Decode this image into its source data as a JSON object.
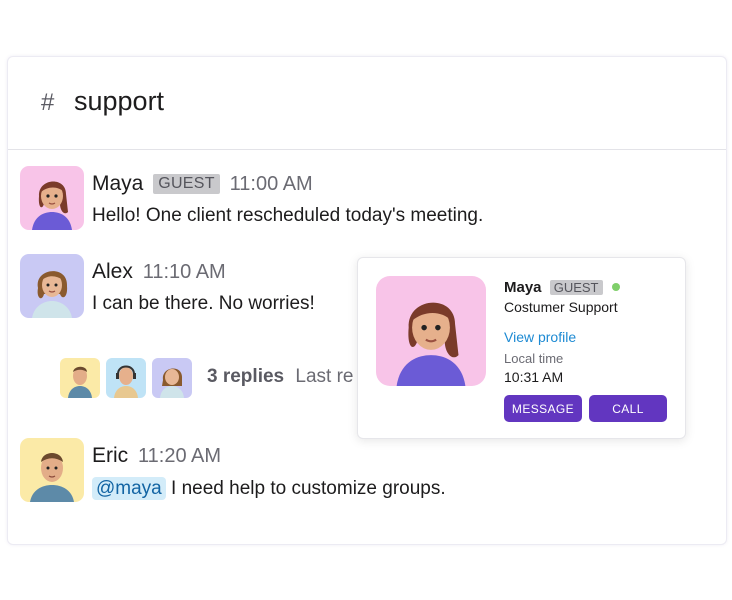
{
  "channel": {
    "hash": "#",
    "name": "support"
  },
  "messages": [
    {
      "author": "Maya",
      "badge": "GUEST",
      "time": "11:00 AM",
      "text": "Hello! One client rescheduled today's meeting."
    },
    {
      "author": "Alex",
      "time": "11:10 AM",
      "text": "I can be there. No worries!"
    },
    {
      "author": "Eric",
      "time": "11:20 AM",
      "mention": "@maya",
      "text": "I need help to customize groups."
    }
  ],
  "thread": {
    "count_label": "3 replies",
    "last_label": "Last re"
  },
  "profile_card": {
    "name": "Maya",
    "badge": "GUEST",
    "role": "Costumer Support",
    "view_profile": "View profile",
    "local_time_label": "Local time",
    "local_time": "10:31 AM",
    "message_button": "MESSAGE",
    "call_button": "CALL"
  },
  "colors": {
    "accent": "#6236c0",
    "link": "#1d8ad3",
    "online": "#7fcf6a",
    "maya_bg": "#f8c4e8",
    "alex_bg": "#c9c9f4",
    "eric_bg": "#fbeaa7"
  }
}
